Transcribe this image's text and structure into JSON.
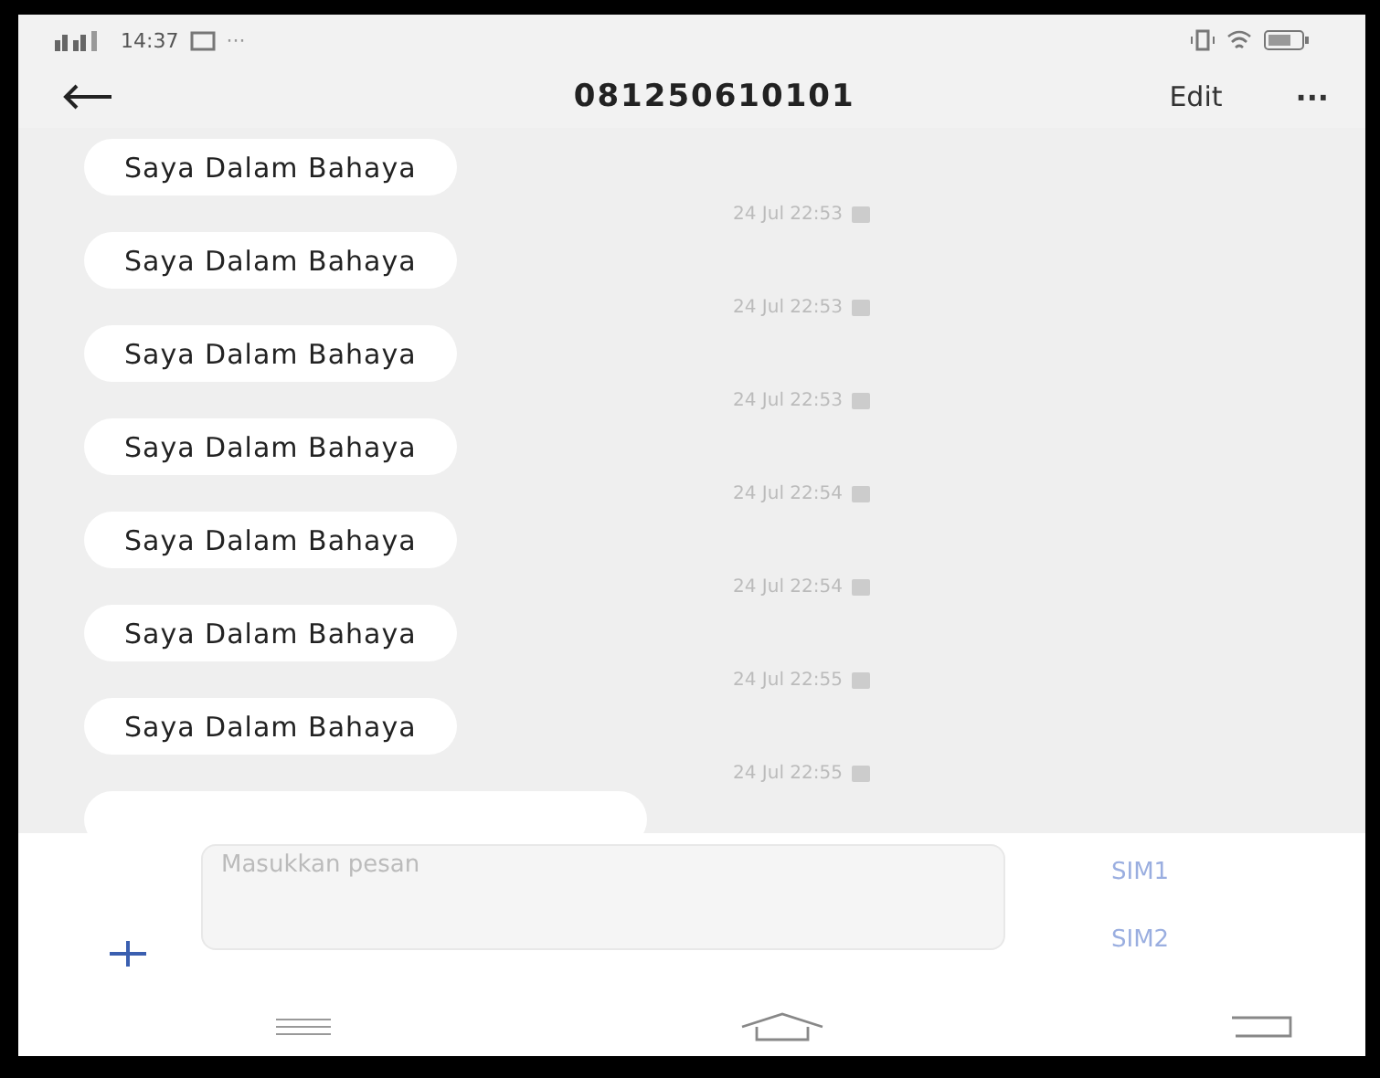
{
  "status_bar": {
    "time": "14:37",
    "more": "···"
  },
  "header": {
    "title": "081250610101",
    "edit": "Edit",
    "menu": "···"
  },
  "messages": [
    {
      "text": "Saya Dalam Bahaya",
      "time": "24 Jul 22:53"
    },
    {
      "text": "Saya Dalam Bahaya",
      "time": "24 Jul 22:53"
    },
    {
      "text": "Saya Dalam Bahaya",
      "time": "24 Jul 22:53"
    },
    {
      "text": "Saya Dalam Bahaya",
      "time": "24 Jul 22:54"
    },
    {
      "text": "Saya Dalam Bahaya",
      "time": "24 Jul 22:54"
    },
    {
      "text": "Saya Dalam Bahaya",
      "time": "24 Jul 22:55"
    },
    {
      "text": "Saya Dalam Bahaya",
      "time": "24 Jul 22:55"
    }
  ],
  "composer": {
    "placeholder": "Masukkan pesan",
    "sim_buttons": [
      "SIM1",
      "SIM2"
    ]
  }
}
